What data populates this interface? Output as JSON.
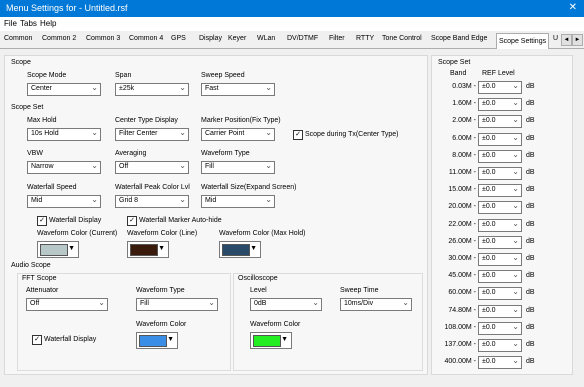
{
  "window": {
    "title": "Menu Settings for  - Untitled.rsf",
    "close": "✕"
  },
  "menubar": [
    "File",
    "Tabs",
    "Help"
  ],
  "tabs": [
    "Common",
    "Common 2",
    "Common 3",
    "Common 4",
    "GPS",
    "Display",
    "Keyer",
    "WLan",
    "DV/DTMF",
    "Filter",
    "RTTY",
    "Tone Control",
    "Scope Band Edge",
    "Scope Settings",
    "U"
  ],
  "selected_tab": "Scope Settings",
  "tab_nav": {
    "left": "◄",
    "right": "►"
  },
  "scope": {
    "title": "Scope",
    "mode": {
      "label": "Scope Mode",
      "value": "Center"
    },
    "span": {
      "label": "Span",
      "value": "±25k"
    },
    "sweep": {
      "label": "Sweep Speed",
      "value": "Fast"
    }
  },
  "scope_set": {
    "title": "Scope Set",
    "max_hold": {
      "label": "Max Hold",
      "value": "10s Hold"
    },
    "center_type": {
      "label": "Center Type Display",
      "value": "Filter Center"
    },
    "marker_pos": {
      "label": "Marker Position(Fix Type)",
      "value": "Carrier Point"
    },
    "scope_tx": {
      "label": "Scope during Tx(Center Type)",
      "checked": true
    },
    "vbw": {
      "label": "VBW",
      "value": "Narrow"
    },
    "averaging": {
      "label": "Averaging",
      "value": "Off"
    },
    "waveform_type": {
      "label": "Waveform Type",
      "value": "Fill"
    },
    "wf_speed": {
      "label": "Waterfall Speed",
      "value": "Mid"
    },
    "wf_peak": {
      "label": "Waterfall Peak Color Lvl",
      "value": "Grid 8"
    },
    "wf_size": {
      "label": "Waterfall Size(Expand Screen)",
      "value": "Mid"
    },
    "wf_display": {
      "label": "Waterfall Display",
      "checked": true
    },
    "wf_marker": {
      "label": "Waterfall Marker Auto-hide",
      "checked": true
    },
    "wc_current": {
      "label": "Waveform Color (Current)",
      "color": "#b8c8c8"
    },
    "wc_line": {
      "label": "Waveform Color (Line)",
      "color": "#3a1a0a"
    },
    "wc_max": {
      "label": "Waveform Color (Max Hold)",
      "color": "#2a4a6a"
    }
  },
  "audio_scope": {
    "title": "Audio Scope",
    "fft_title": "FFT Scope",
    "attenuator": {
      "label": "Attenuator",
      "value": "Off"
    },
    "fft_wave_type": {
      "label": "Waveform Type",
      "value": "Fill"
    },
    "fft_wf_display": {
      "label": "Waterfall Display",
      "checked": true
    },
    "fft_wave_color": {
      "label": "Waveform Color",
      "color": "#3a8ee6"
    },
    "osc_title": "Oscilloscope",
    "osc_level": {
      "label": "Level",
      "value": "0dB"
    },
    "osc_sweep": {
      "label": "Sweep Time",
      "value": "10ms/Div"
    },
    "osc_wave_color": {
      "label": "Waveform Color",
      "color": "#22ee22"
    }
  },
  "right_scope_set": {
    "title": "Scope Set",
    "band_header": "Band",
    "ref_header": "REF Level",
    "unit": "dB",
    "rows": [
      {
        "band": "0.03M -",
        "value": "±0.0"
      },
      {
        "band": "1.60M -",
        "value": "±0.0"
      },
      {
        "band": "2.00M -",
        "value": "±0.0"
      },
      {
        "band": "6.00M -",
        "value": "±0.0"
      },
      {
        "band": "8.00M -",
        "value": "±0.0"
      },
      {
        "band": "11.00M -",
        "value": "±0.0"
      },
      {
        "band": "15.00M -",
        "value": "±0.0"
      },
      {
        "band": "20.00M -",
        "value": "±0.0"
      },
      {
        "band": "22.00M -",
        "value": "±0.0"
      },
      {
        "band": "26.00M -",
        "value": "±0.0"
      },
      {
        "band": "30.00M -",
        "value": "±0.0"
      },
      {
        "band": "45.00M -",
        "value": "±0.0"
      },
      {
        "band": "60.00M -",
        "value": "±0.0"
      },
      {
        "band": "74.80M -",
        "value": "±0.0"
      },
      {
        "band": "108.00M -",
        "value": "±0.0"
      },
      {
        "band": "137.00M -",
        "value": "±0.0"
      },
      {
        "band": "400.00M -",
        "value": "±0.0"
      }
    ]
  },
  "dropdown_arrow": "⌄",
  "color_arrow": "▼",
  "check_mark": "✓"
}
